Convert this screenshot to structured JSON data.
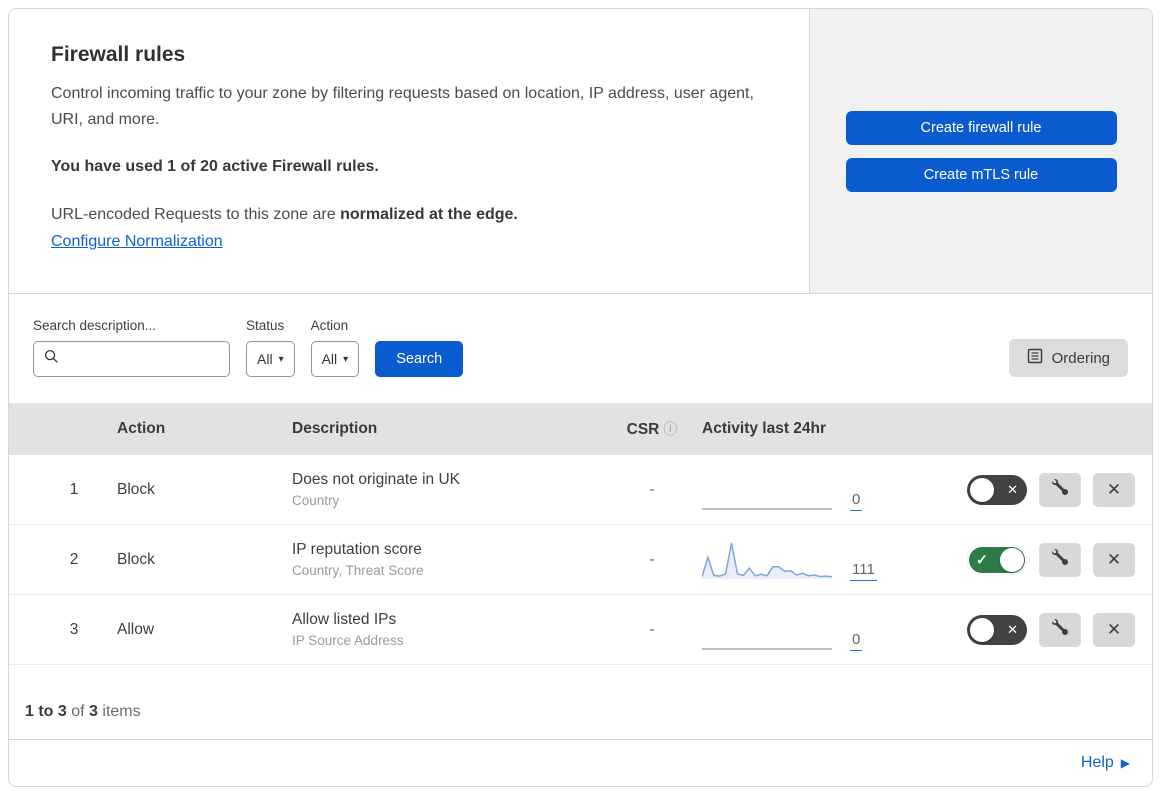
{
  "colors": {
    "primary_blue": "#0b5bd0",
    "link_blue": "#0d62cf",
    "toggle_on_green": "#2d7c47",
    "toggle_off_gray": "#424242",
    "sparkline_blue": "#7da6dc",
    "panel_gray": "#f1f1f1",
    "table_header_gray": "#e2e2e2"
  },
  "header": {
    "title": "Firewall rules",
    "description": "Control incoming traffic to your zone by filtering requests based on location, IP address, user agent, URI, and more.",
    "usage_bold": "You have used 1 of 20 active Firewall rules.",
    "normalization_prefix": "URL-encoded Requests to this zone are ",
    "normalization_bold": "normalized at the edge.",
    "normalization_link": "Configure Normalization",
    "create_firewall_rule_label": "Create firewall rule",
    "create_mtls_rule_label": "Create mTLS rule"
  },
  "filters": {
    "search_label": "Search description...",
    "status_label": "Status",
    "status_value": "All",
    "action_label": "Action",
    "action_value": "All",
    "search_button_label": "Search",
    "ordering_button_label": "Ordering"
  },
  "table": {
    "columns": {
      "action": "Action",
      "description": "Description",
      "csr": "CSR",
      "csr_info": "ⓘ",
      "activity": "Activity last 24hr"
    },
    "rows": [
      {
        "priority": "1",
        "action": "Block",
        "description": "Does not originate in UK",
        "fields": "Country",
        "csr": "-",
        "activity_count": "0",
        "enabled": false,
        "sparkline": []
      },
      {
        "priority": "2",
        "action": "Block",
        "description": "IP reputation score",
        "fields": "Country, Threat Score",
        "csr": "-",
        "activity_count": "111",
        "enabled": true,
        "sparkline": [
          6,
          60,
          10,
          8,
          14,
          100,
          14,
          10,
          30,
          9,
          13,
          9,
          34,
          34,
          21,
          23,
          11,
          16,
          9,
          11,
          7,
          8,
          6
        ]
      },
      {
        "priority": "3",
        "action": "Allow",
        "description": "Allow listed IPs",
        "fields": "IP Source Address",
        "csr": "-",
        "activity_count": "0",
        "enabled": false,
        "sparkline": []
      }
    ]
  },
  "footer": {
    "range_bold": "1 to 3",
    "of_text": " of ",
    "total_bold": "3",
    "items_text": " items"
  },
  "help": {
    "label": "Help"
  }
}
